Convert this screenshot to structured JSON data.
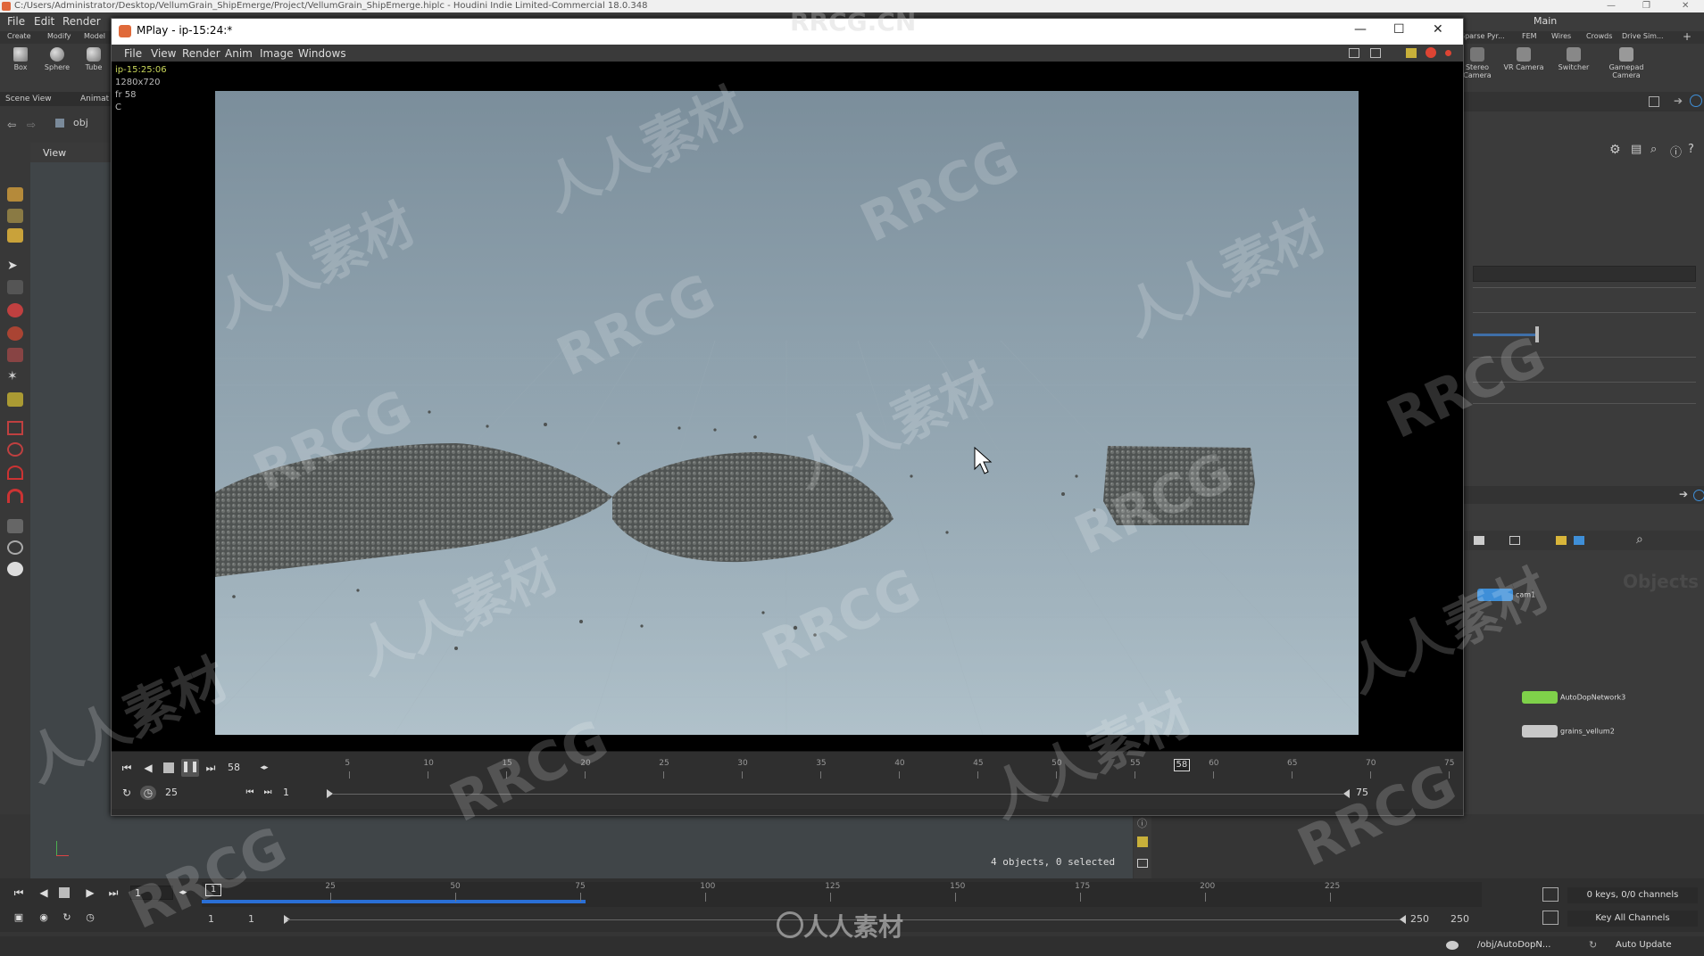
{
  "main_window": {
    "title": "C:/Users/Administrator/Desktop/VellumGrain_ShipEmerge/Project/VellumGrain_ShipEmerge.hiplc - Houdini Indie Limited-Commercial 18.0.348",
    "menu": [
      "File",
      "Edit",
      "Render"
    ],
    "desktop_label": "Main"
  },
  "shelf": {
    "tabs": [
      "Create",
      "Modify",
      "Model"
    ],
    "tools": [
      "Box",
      "Sphere",
      "Tube"
    ],
    "right_tabs": [
      "Sparse Pyr...",
      "FEM",
      "Wires",
      "Crowds",
      "Drive Sim..."
    ],
    "right_tools": [
      "Stereo Camera",
      "VR Camera",
      "Switcher",
      "Gamepad Camera"
    ]
  },
  "scene_view": {
    "tabs": [
      "Scene View",
      "Animat"
    ],
    "path": "obj",
    "view_label": "View",
    "status": "4 objects, 0 selected"
  },
  "mplay": {
    "title": "MPlay - ip-15:24:*",
    "menu": [
      "File",
      "View",
      "Render",
      "Anim",
      "Image",
      "Windows"
    ],
    "info": [
      "ip-15:25:06",
      "1280x720",
      "fr 58",
      "C"
    ],
    "timeline": {
      "current_frame": "58",
      "fps": "25",
      "start": "1",
      "end": "75",
      "marker": "58",
      "ticks": [
        "5",
        "10",
        "15",
        "20",
        "25",
        "30",
        "35",
        "40",
        "45",
        "50",
        "55",
        "60",
        "65",
        "70",
        "75"
      ]
    }
  },
  "houdini_timeline": {
    "current_frame": "1",
    "marker": "1",
    "start": "1",
    "start2": "1",
    "end": "250",
    "end2": "250",
    "ticks": [
      "25",
      "50",
      "75",
      "100",
      "125",
      "150",
      "175",
      "200",
      "225"
    ],
    "range_progress": 0.3
  },
  "channels": {
    "keys_label": "0 keys, 0/0 channels",
    "key_all": "Key All Channels"
  },
  "network": {
    "label": "Objects",
    "nodes": [
      "cam1",
      "AutoDopNetwork3",
      "grains_vellum2"
    ]
  },
  "status_bar": {
    "path": "/obj/AutoDopN...",
    "update": "Auto Update"
  },
  "watermark": {
    "text1": "RRCG",
    "text2": "人人素材",
    "site": "RRCG.CN"
  },
  "colors": {
    "info_text": "#c9d75a",
    "timeline_blue": "#2a6fd6",
    "node_green": "#7fd14a",
    "node_blue": "#3f8fd8"
  }
}
